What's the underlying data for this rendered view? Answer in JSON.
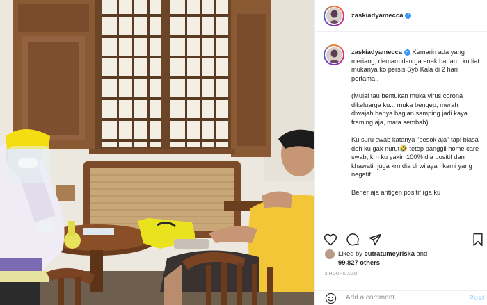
{
  "post": {
    "username": "zaskiadyamecca",
    "verified": true,
    "caption_paragraphs": [
      "Kemarin ada yang meriang, demam dan ga enak badan.. ku liat mukanya ko persis Syb Kala di 2 hari pertama..",
      "(Mulai tau bentukan muka virus corona dikeluarga ku... muka bengep, merah diwajah hanya bagian samping jadi kaya framing aja, mata sembab)",
      "Ku suru swab katanya \"besok aja\" tapi biasa deh ku gak nurut🤣 tetep panggil home care swab, krn ku yakin 100% dia positif dan khawatir juga krn dia di wilayah kami yang negatif..",
      "Bener aja antigen positif (ga ku"
    ],
    "likes": {
      "liked_by_prefix": "Liked by",
      "liked_by_user": "cutratumeyriska",
      "and_text": "and",
      "others_count": "99,827 others"
    },
    "timestamp": "2 HOURS AGO",
    "comment_placeholder": "Add a comment...",
    "post_label": "Post"
  },
  "icons": {
    "like": "heart-icon",
    "comment": "comment-icon",
    "share": "share-icon",
    "save": "bookmark-icon",
    "emoji": "emoji-icon",
    "verified": "verified-badge-icon"
  },
  "colors": {
    "verified_blue": "#3897f0",
    "post_button_disabled": "#b3dbff",
    "muted_text": "#8e8e8e"
  }
}
